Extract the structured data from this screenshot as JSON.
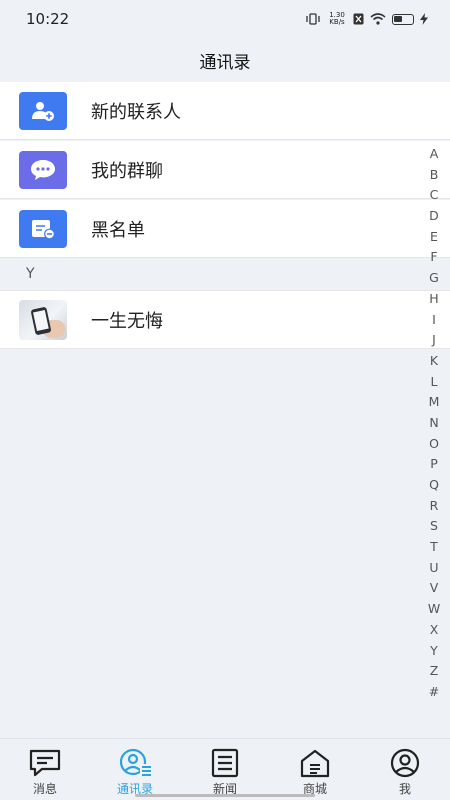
{
  "status": {
    "time": "10:22",
    "net_speed_top": "1.30",
    "net_speed_bottom": "KB/s"
  },
  "header": {
    "title": "通讯录"
  },
  "menu": [
    {
      "label": "新的联系人",
      "icon": "person-add-icon",
      "color": "#3f7af0"
    },
    {
      "label": "我的群聊",
      "icon": "chat-bubble-icon",
      "color": "#6b6de8"
    },
    {
      "label": "黑名单",
      "icon": "blacklist-icon",
      "color": "#3f7af0"
    }
  ],
  "sections": [
    {
      "letter": "Y",
      "contacts": [
        {
          "name": "一生无悔"
        }
      ]
    }
  ],
  "alphabet": [
    "A",
    "B",
    "C",
    "D",
    "E",
    "F",
    "G",
    "H",
    "I",
    "J",
    "K",
    "L",
    "M",
    "N",
    "O",
    "P",
    "Q",
    "R",
    "S",
    "T",
    "U",
    "V",
    "W",
    "X",
    "Y",
    "Z",
    "#"
  ],
  "nav": [
    {
      "label": "消息",
      "icon": "message-icon",
      "active": false
    },
    {
      "label": "通讯录",
      "icon": "contacts-icon",
      "active": true
    },
    {
      "label": "新闻",
      "icon": "news-icon",
      "active": false
    },
    {
      "label": "商城",
      "icon": "shop-icon",
      "active": false
    },
    {
      "label": "我",
      "icon": "profile-icon",
      "active": false
    }
  ],
  "colors": {
    "accent": "#2aa3dc",
    "icon_blue": "#3f7af0",
    "icon_purple": "#6b6de8"
  }
}
